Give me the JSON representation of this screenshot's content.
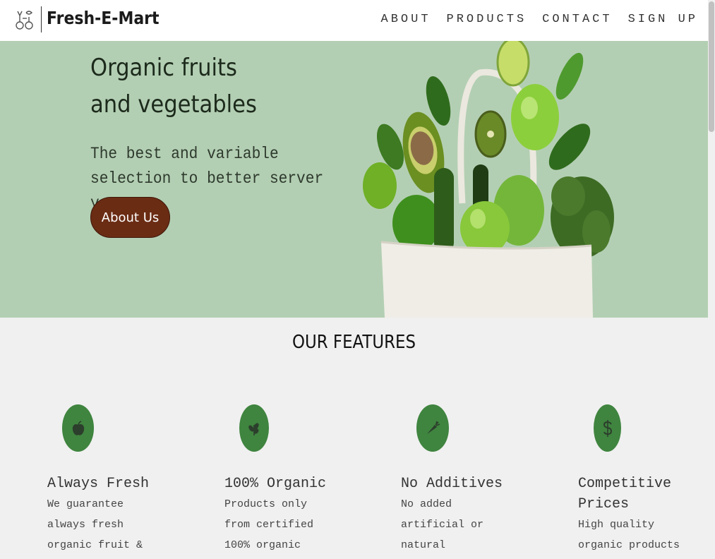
{
  "navbar": {
    "brand": "Fresh-E-Mart",
    "links": [
      "ABOUT",
      "PRODUCTS",
      "CONTACT",
      "SIGN UP"
    ]
  },
  "hero": {
    "title": "Organic fruits and vegetables",
    "subtitle": "The best and variable selection to better server you.",
    "button_label": "About Us",
    "image": "grocery-bag-vegetables-image"
  },
  "features": {
    "title": "OUR FEATURES",
    "items": [
      {
        "icon": "apple-icon",
        "title": "Always Fresh",
        "text_lines": [
          "We guarantee",
          "always fresh",
          "organic fruit &"
        ]
      },
      {
        "icon": "leaf-icon",
        "title": "100% Organic",
        "text_lines": [
          "Products only",
          "from certified",
          "100% organic"
        ]
      },
      {
        "icon": "carrot-icon",
        "title": "No Additives",
        "text_lines": [
          "No added",
          "artificial or",
          "natural"
        ]
      },
      {
        "icon": "dollar-icon",
        "title_lines": [
          "Competitive",
          "Prices"
        ],
        "text_lines": [
          "High quality",
          "organic products"
        ]
      }
    ]
  },
  "colors": {
    "hero_bg": "#b3cfb3",
    "button_bg": "#6b2c14",
    "icon_bg": "#3f843f",
    "page_bg": "#f0f0f0"
  }
}
